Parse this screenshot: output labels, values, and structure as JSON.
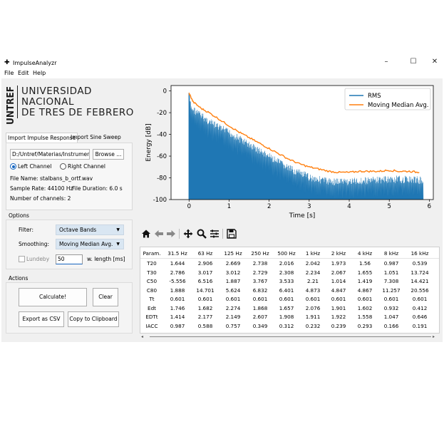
{
  "window": {
    "title": "ImpulseAnalyzr",
    "controls": [
      "–",
      "☐",
      "✕"
    ]
  },
  "menu": [
    "File",
    "Edit",
    "Help"
  ],
  "logo": {
    "vertical": "UNTREF",
    "lines": [
      "UNIVERSIDAD",
      "NACIONAL",
      "DE TRES DE FEBRERO"
    ]
  },
  "tabs": [
    "Import Impulse Response",
    "Import Sine Sweep"
  ],
  "import": {
    "path": "D:/Untref/Materias/Instrument",
    "browse_label": "Browse ...",
    "channels": [
      "Left Channel",
      "Right Channel"
    ],
    "selected_channel": "Left Channel",
    "file_name": "File Name: stalbans_b_ortf.wav",
    "sample_rate": "Sample Rate: 44100 Hz",
    "file_duration": "File Duration: 6.0 s",
    "num_channels": "Number of channels: 2"
  },
  "options": {
    "title": "Options",
    "filter_label": "Filter:",
    "filter_value": "Octave Bands",
    "smoothing_label": "Smoothing:",
    "smoothing_value": "Moving Median Avg.",
    "lundeby_label": "Lundeby",
    "window_value": "50",
    "window_label": "w. length [ms]"
  },
  "actions": {
    "title": "Actions",
    "calculate": "Calculate!",
    "clear": "Clear",
    "export": "Export as CSV",
    "copy": "Copy to Clipboard"
  },
  "chart_data": {
    "type": "line",
    "xlabel": "Time [s]",
    "ylabel": "Energy [dB]",
    "xlim": [
      -0.45,
      6.1
    ],
    "ylim": [
      -100,
      5
    ],
    "xticks": [
      0,
      1,
      2,
      3,
      4,
      5,
      6
    ],
    "yticks": [
      0,
      -20,
      -40,
      -60,
      -80,
      -100
    ],
    "legend_position": "top-right",
    "series": [
      {
        "name": "RMS",
        "color": "#1f77b4",
        "style": "filled-noise",
        "x": [
          0,
          0.05,
          0.5,
          1.0,
          1.5,
          2.0,
          2.5,
          3.0,
          3.5,
          4.0,
          4.5,
          5.0,
          5.5,
          5.85
        ],
        "upper": [
          -1,
          -12,
          -25,
          -35,
          -46,
          -57,
          -68,
          -76,
          -80,
          -80,
          -79,
          -78,
          -78,
          -79
        ],
        "lower": -100
      },
      {
        "name": "Moving Median Avg.",
        "color": "#ff7f0e",
        "x": [
          0,
          0.1,
          0.3,
          0.5,
          0.75,
          1.0,
          1.25,
          1.5,
          1.75,
          2.0,
          2.25,
          2.5,
          2.75,
          3.0,
          3.25,
          3.5,
          3.75,
          4.0,
          4.25,
          4.5,
          4.75,
          5.0,
          5.25,
          5.5,
          5.75
        ],
        "y": [
          -2,
          -10,
          -16,
          -20,
          -26,
          -32,
          -38,
          -43,
          -48,
          -53,
          -58,
          -63,
          -67,
          -70,
          -72,
          -74,
          -75,
          -75,
          -74,
          -74,
          -74,
          -73,
          -74,
          -74,
          -75
        ]
      }
    ]
  },
  "toolbar_icons": [
    "home-icon",
    "back-arrow-icon",
    "forward-arrow-icon",
    "pan-icon",
    "zoom-icon",
    "configure-icon",
    "save-icon"
  ],
  "results": {
    "headers": [
      "Param.",
      "31.5 Hz",
      "63 Hz",
      "125 Hz",
      "250 Hz",
      "500 Hz",
      "1 kHz",
      "2 kHz",
      "4 kHz",
      "8 kHz",
      "16 kHz"
    ],
    "rows": [
      [
        "T20",
        "1.644",
        "2.906",
        "2.669",
        "2.738",
        "2.016",
        "2.042",
        "1.973",
        "1.56",
        "0.987",
        "0.539"
      ],
      [
        "T30",
        "2.786",
        "3.017",
        "3.012",
        "2.729",
        "2.308",
        "2.234",
        "2.067",
        "1.655",
        "1.051",
        "13.724"
      ],
      [
        "C50",
        "-5.556",
        "6.516",
        "1.887",
        "3.767",
        "3.533",
        "2.21",
        "1.014",
        "1.419",
        "7.308",
        "14.421"
      ],
      [
        "C80",
        "1.888",
        "14.701",
        "5.624",
        "6.832",
        "6.401",
        "4.873",
        "4.847",
        "4.867",
        "11.257",
        "20.556"
      ],
      [
        "Tt",
        "0.601",
        "0.601",
        "0.601",
        "0.601",
        "0.601",
        "0.601",
        "0.601",
        "0.601",
        "0.601",
        "0.601"
      ],
      [
        "Edt",
        "1.746",
        "1.682",
        "2.274",
        "1.868",
        "1.657",
        "2.076",
        "1.901",
        "1.602",
        "0.932",
        "0.412"
      ],
      [
        "EDTt",
        "1.414",
        "2.177",
        "2.149",
        "2.607",
        "1.908",
        "1.911",
        "1.922",
        "1.558",
        "1.047",
        "0.646"
      ],
      [
        "IACC",
        "0.987",
        "0.588",
        "0.757",
        "0.349",
        "0.312",
        "0.232",
        "0.239",
        "0.293",
        "0.166",
        "0.191"
      ]
    ]
  }
}
